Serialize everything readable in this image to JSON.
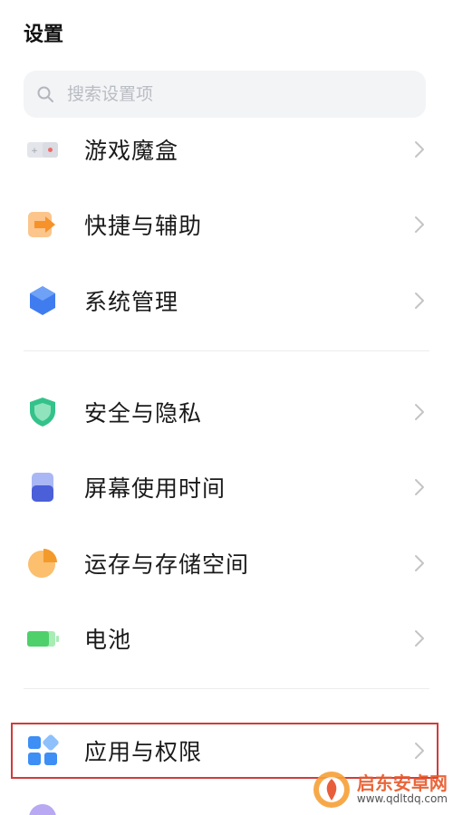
{
  "header": {
    "title": "设置"
  },
  "search": {
    "placeholder": "搜索设置项",
    "icon": "search-icon"
  },
  "settings_items": [
    {
      "label": "游戏魔盒",
      "icon": "game-box-icon"
    },
    {
      "label": "快捷与辅助",
      "icon": "shortcut-arrow-icon"
    },
    {
      "label": "系统管理",
      "icon": "hexagon-icon"
    },
    {
      "label": "安全与隐私",
      "icon": "shield-icon"
    },
    {
      "label": "屏幕使用时间",
      "icon": "screen-time-icon"
    },
    {
      "label": "运存与存储空间",
      "icon": "pie-chart-icon"
    },
    {
      "label": "电池",
      "icon": "battery-icon"
    },
    {
      "label": "应用与权限",
      "icon": "apps-grid-icon",
      "highlighted": true
    }
  ],
  "colors": {
    "highlight_border": "#d23b3b",
    "chevron": "#c4c4c4",
    "watermark_text": "#e85a2a"
  },
  "watermark": {
    "title": "启东安卓网",
    "url": "www.qdltdq.com"
  }
}
